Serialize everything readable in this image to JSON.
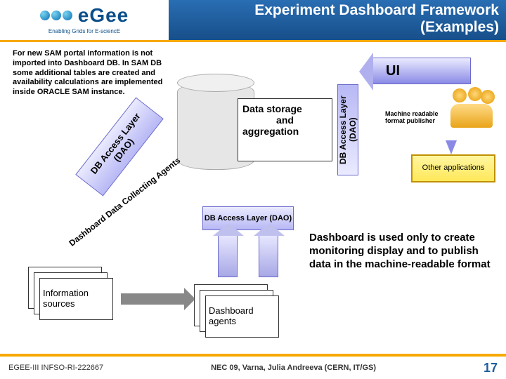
{
  "header": {
    "logo_text": "eGee",
    "tagline": "Enabling Grids for E-sciencE",
    "title_line1": "Experiment Dashboard Framework",
    "title_line2": "(Examples)"
  },
  "sam_text": "For new SAM portal information is not imported into Dashboard DB. In SAM DB some additional tables are created and availability calculations are implemented inside ORACLE SAM instance.",
  "dao_label": "DB Access Layer (DAO)",
  "data_storage_line1": "Data storage",
  "data_storage_line2": "and",
  "data_storage_line3": "aggregation",
  "dao_vertical": "DB Access Layer (DAO)",
  "ui_label": "UI",
  "machine_text": "Machine readable format publisher",
  "other_apps": "Other applications",
  "collect_label": "Dashboard Data Collecting Agents",
  "dao_h": "DB Access Layer (DAO)",
  "info_sources": "Information sources",
  "dash_agents": "Dashboard agents",
  "explain": "Dashboard is used only to create monitoring display and to publish data in the machine-readable format",
  "footer": {
    "left": "EGEE-III INFSO-RI-222667",
    "center": "NEC 09, Varna,  Julia Andreeva (CERN, IT/GS)",
    "page": "17"
  }
}
